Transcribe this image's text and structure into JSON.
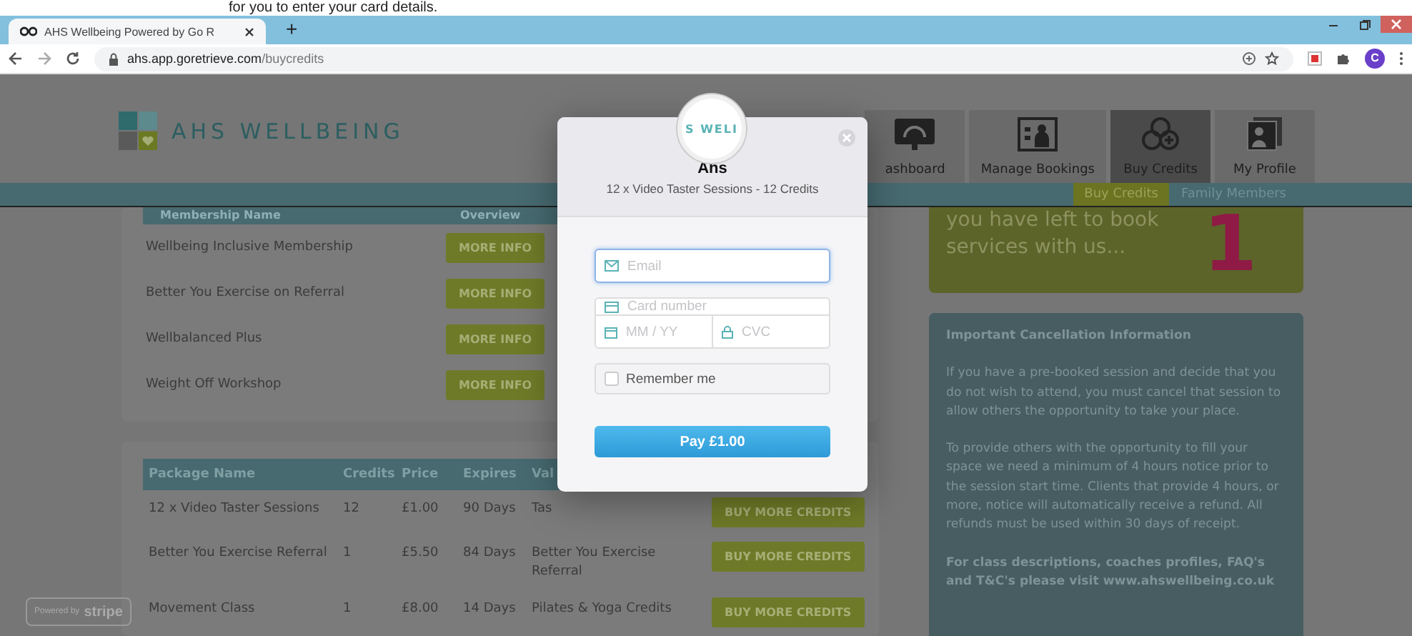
{
  "caption": "for you to enter your card details.",
  "browser": {
    "tab_title": "AHS Wellbeing Powered by Go R",
    "new_tab": "+",
    "url_host": "ahs.app.goretrieve.com",
    "url_path": "/buycredits",
    "profile_initial": "C"
  },
  "site": {
    "brand": "AHS WELLBEING",
    "nav": [
      {
        "label": "ashboard",
        "kind": "dashboard",
        "selected": false
      },
      {
        "label": "Manage Bookings",
        "kind": "bookings",
        "selected": false
      },
      {
        "label": "Buy Credits",
        "kind": "credits",
        "selected": true
      },
      {
        "label": "My Profile",
        "kind": "profile",
        "selected": false
      }
    ],
    "subnav": [
      {
        "label": "Buy Credits",
        "selected": true
      },
      {
        "label": "Family Members",
        "selected": false
      }
    ]
  },
  "memberships": {
    "columns": [
      "Membership Name",
      "Overview"
    ],
    "rows": [
      {
        "name": "Wellbeing Inclusive Membership",
        "action": "MORE INFO"
      },
      {
        "name": "Better You Exercise on Referral",
        "action": "MORE INFO"
      },
      {
        "name": "Wellbalanced Plus",
        "action": "MORE INFO"
      },
      {
        "name": "Weight Off Workshop",
        "action": "MORE INFO"
      }
    ]
  },
  "packages": {
    "columns": [
      "Package Name",
      "Credits",
      "Price",
      "Expires",
      "Val"
    ],
    "rows": [
      {
        "name": "12 x Video Taster Sessions",
        "credits": "12",
        "price": "£1.00",
        "expires": "90 Days",
        "value": "Tas",
        "action": "BUY MORE CREDITS"
      },
      {
        "name": "Better You Exercise Referral",
        "credits": "1",
        "price": "£5.50",
        "expires": "84 Days",
        "value": "Better You Exercise Referral",
        "action": "BUY MORE CREDITS"
      },
      {
        "name": "Movement Class",
        "credits": "1",
        "price": "£8.00",
        "expires": "14 Days",
        "value": "Pilates & Yoga Credits",
        "action": "BUY MORE CREDITS"
      }
    ]
  },
  "credits_card": {
    "text": "you have left to book services with us...",
    "count": "1"
  },
  "info_card": {
    "title": "Important Cancellation Information",
    "paragraphs": [
      "If you have a pre-booked session and decide that you do not wish to attend, you must cancel that session to allow others the opportunity to take your place.",
      "To provide others with the opportunity to fill your space we need a minimum of 4 hours notice prior to the session start time. Clients that provide 4 hours, or more, notice will automatically receive a refund. All refunds must be used within 30 days of receipt."
    ],
    "footer": "For class descriptions, coaches profiles, FAQ's and T&C's please visit www.ahswellbeing.co.uk"
  },
  "checkout": {
    "logo_text": "S WELI",
    "merchant": "Ahs",
    "description": "12 x Video Taster Sessions - 12 Credits",
    "email_placeholder": "Email",
    "email_focused": true,
    "card_placeholder": "Card number",
    "expiry_placeholder": "MM / YY",
    "cvc_placeholder": "CVC",
    "remember_label": "Remember me",
    "remember_checked": false,
    "pay_label": "Pay £1.00"
  },
  "stripe_badge": {
    "prefix": "Powered by",
    "brand": "stripe"
  }
}
